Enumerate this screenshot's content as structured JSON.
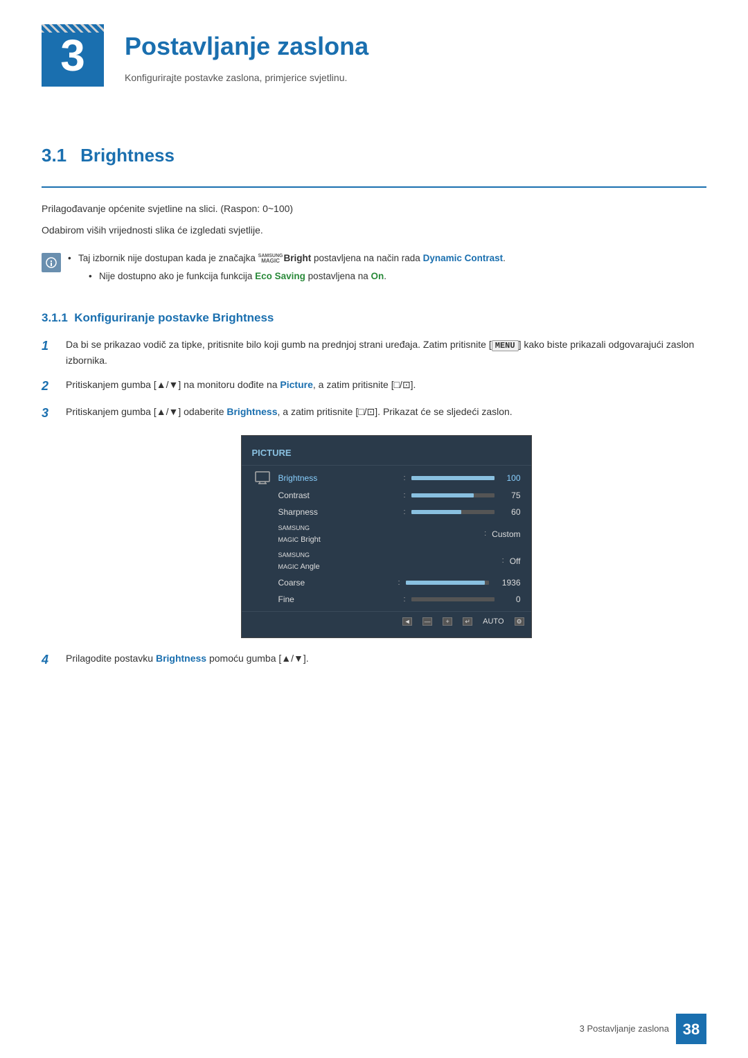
{
  "header": {
    "chapter_number": "3",
    "chapter_title": "Postavljanje zaslona",
    "chapter_subtitle": "Konfigurirajte postavke zaslona, primjerice svjetlinu."
  },
  "section": {
    "number": "3.1",
    "title": "Brightness",
    "divider": true
  },
  "intro": {
    "line1": "Prilagođavanje općenite svjetline na slici. (Raspon: 0~100)",
    "line2": "Odabirom viših vrijednosti slika će izgledati svjetlije."
  },
  "notes": {
    "icon_label": "i",
    "bullet1_prefix": "Taj izbornik nije dostupan kada je značajka ",
    "bullet1_brand": "SAMSUNG MAGIC",
    "bullet1_label": "Bright",
    "bullet1_middle": " postavljena na način rada ",
    "bullet1_bold": "Dynamic Contrast",
    "bullet1_suffix": ".",
    "bullet2_prefix": "Nije dostupno ako je funkcija funkcija ",
    "bullet2_label": "Eco Saving",
    "bullet2_middle": " postavljena na ",
    "bullet2_bold": "On",
    "bullet2_suffix": "."
  },
  "subsection": {
    "number": "3.1.1",
    "title": "Konfiguriranje postavke Brightness"
  },
  "steps": [
    {
      "number": "1",
      "text_parts": [
        {
          "text": "Da bi se prikazao vodič za tipke, pritisnite bilo koji gumb na prednjoj strani uređaja. Zatim pritisnite ["
        },
        {
          "text": "MENU",
          "style": "key"
        },
        {
          "text": "] kako biste prikazali odgovarajući zaslon izbornika."
        }
      ]
    },
    {
      "number": "2",
      "text_parts": [
        {
          "text": "Pritiskanjem gumba [▲/▼] na monitoru dođite na "
        },
        {
          "text": "Picture",
          "style": "bold-blue"
        },
        {
          "text": ", a zatim pritisnite [□/⊡]."
        }
      ]
    },
    {
      "number": "3",
      "text_parts": [
        {
          "text": "Pritiskanjem gumba [▲/▼] odaberite "
        },
        {
          "text": "Brightness",
          "style": "bold-blue"
        },
        {
          "text": ", a zatim pritisnite [□/⊡]. Prikazat će se sljedeći zaslon."
        }
      ]
    },
    {
      "number": "4",
      "text_parts": [
        {
          "text": "Prilagodite postavku "
        },
        {
          "text": "Brightness",
          "style": "bold-blue"
        },
        {
          "text": " pomoću gumba [▲/▼]."
        }
      ]
    }
  ],
  "picture_menu": {
    "title": "PICTURE",
    "items": [
      {
        "label": "Brightness",
        "type": "bar",
        "value": 100,
        "max": 100,
        "active": true
      },
      {
        "label": "Contrast",
        "type": "bar",
        "value": 75,
        "max": 100,
        "active": false
      },
      {
        "label": "Sharpness",
        "type": "bar",
        "value": 60,
        "max": 100,
        "active": false
      },
      {
        "label": "SAMSUNG MAGIC Bright",
        "type": "text",
        "value": "Custom",
        "active": false
      },
      {
        "label": "SAMSUNG MAGIC Angle",
        "type": "text",
        "value": "Off",
        "active": false
      },
      {
        "label": "Coarse",
        "type": "bar",
        "value": 1936,
        "max": 1936,
        "active": false
      },
      {
        "label": "Fine",
        "type": "bar",
        "value": 0,
        "max": 100,
        "active": false
      }
    ],
    "buttons": [
      "◄",
      "—",
      "+",
      "↵",
      "AUTO",
      "⚙"
    ]
  },
  "footer": {
    "text": "3 Postavljanje zaslona",
    "page": "38"
  }
}
